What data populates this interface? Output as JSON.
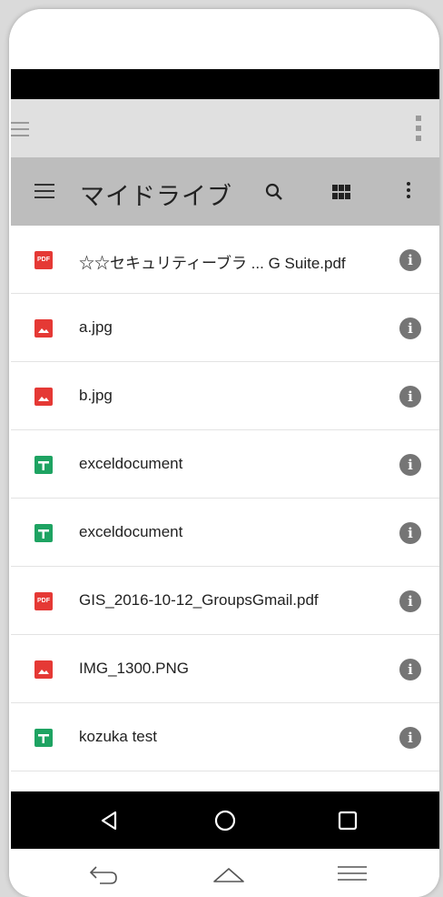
{
  "appbar": {
    "title": "マイドライブ",
    "icons": [
      "menu-icon",
      "search-icon",
      "grid-view-icon",
      "more-vert-icon"
    ]
  },
  "files": [
    {
      "name": "☆☆セキュリティーブラ ... G Suite.pdf",
      "type": "pdf",
      "badge": "PDF"
    },
    {
      "name": "a.jpg",
      "type": "image"
    },
    {
      "name": "b.jpg",
      "type": "image"
    },
    {
      "name": "exceldocument",
      "type": "sheet"
    },
    {
      "name": "exceldocument",
      "type": "sheet"
    },
    {
      "name": "GIS_2016-10-12_GroupsGmail.pdf",
      "type": "pdf",
      "badge": "PDF"
    },
    {
      "name": "IMG_1300.PNG",
      "type": "image"
    },
    {
      "name": "kozuka test",
      "type": "sheet"
    }
  ],
  "info_glyph": "i",
  "colors": {
    "appbar": "#bdbdbd",
    "pdf": "#e53935",
    "image": "#e53935",
    "sheet": "#1ea362",
    "info": "#757575"
  }
}
